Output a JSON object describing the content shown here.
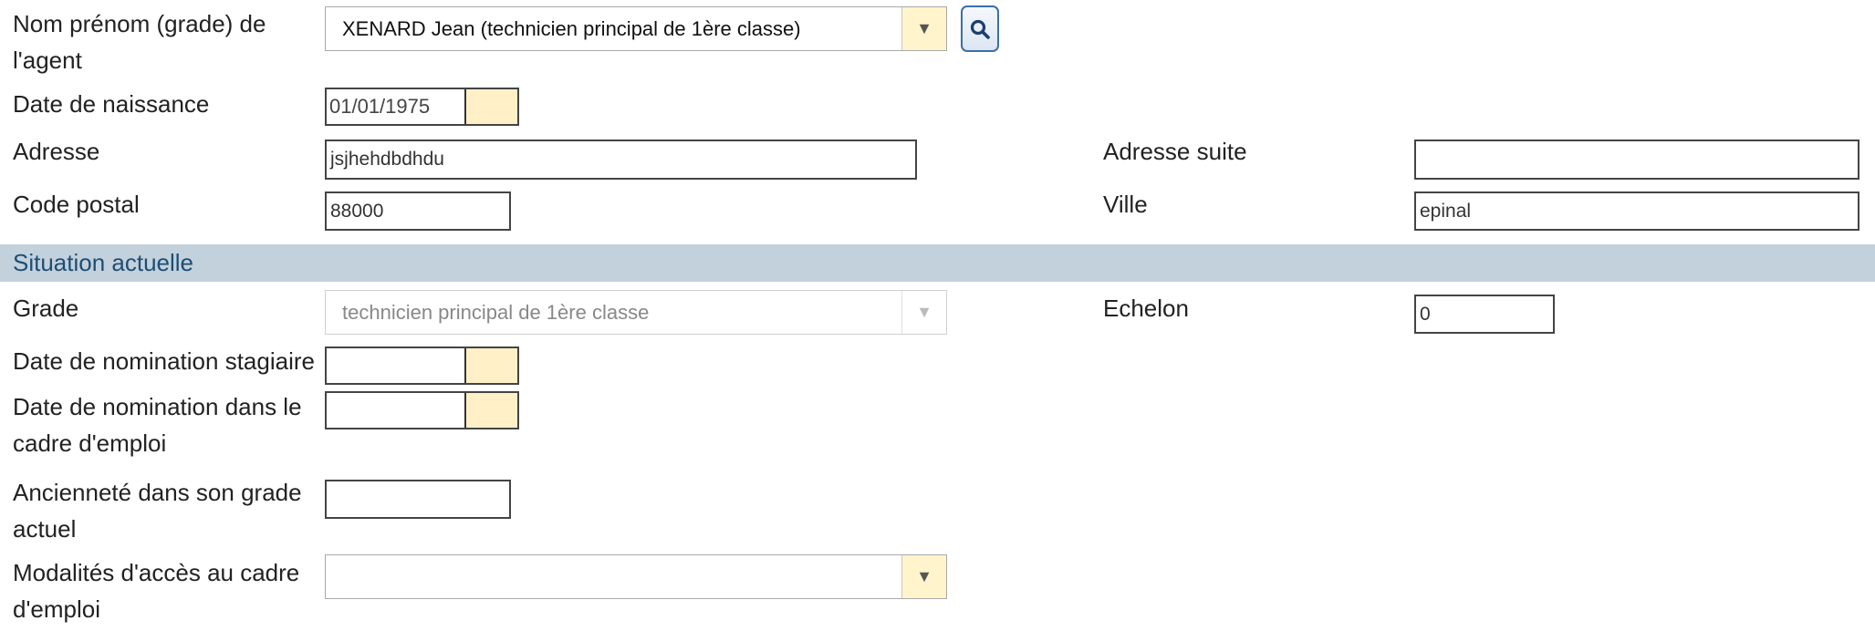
{
  "agent": {
    "label_line1": "Nom prénom (grade) de",
    "label_line2": "l'agent",
    "selected": "XENARD Jean (technicien principal de 1ère classe)",
    "dropdown_icon": "caret-down",
    "search_icon": "magnifier"
  },
  "birth": {
    "label": "Date de naissance",
    "value": "01/01/1975"
  },
  "address": {
    "label": "Adresse",
    "value": "jsjhehdbdhdu",
    "suite_label": "Adresse suite",
    "suite_value": ""
  },
  "postal": {
    "label": "Code postal",
    "value": "88000",
    "city_label": "Ville",
    "city_value": "epinal"
  },
  "section": {
    "title": "Situation actuelle",
    "color": "#c3d1dc"
  },
  "grade": {
    "label": "Grade",
    "value": "technicien principal de 1ère classe",
    "echelon_label": "Echelon",
    "echelon_value": "0"
  },
  "stagiaire": {
    "label": "Date de nomination stagiaire",
    "value": ""
  },
  "cadre": {
    "label_line1": "Date de nomination dans le",
    "label_line2": "cadre d'emploi",
    "value": ""
  },
  "anciennete": {
    "label_line1": "Ancienneté dans son grade",
    "label_line2": "actuel",
    "value": ""
  },
  "modalites": {
    "label_line1": "Modalités d'accès au cadre",
    "label_line2": "d'emploi",
    "value": ""
  }
}
